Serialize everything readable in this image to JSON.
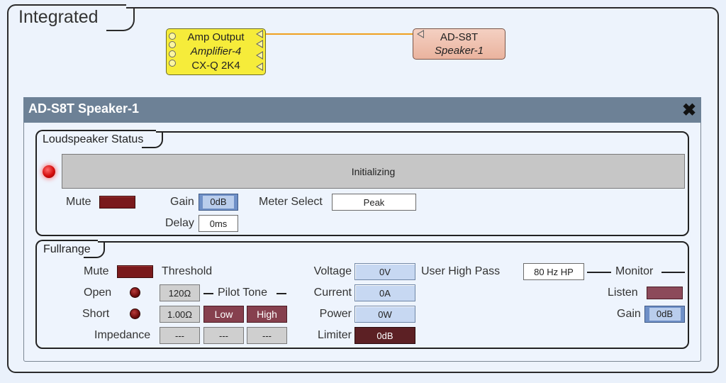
{
  "design": {
    "title": "Integrated"
  },
  "amp_node": {
    "line1": "Amp Output",
    "line2": "Amplifier-4",
    "line3": "CX-Q 2K4",
    "color": "#f6ec3a"
  },
  "speaker_node": {
    "line1": "AD-S8T",
    "line2": "Speaker-1",
    "color": "#eab39e"
  },
  "wire": {
    "color": "#f0a020"
  },
  "dialog": {
    "title": "AD-S8T Speaker-1",
    "close_icon": "close-icon",
    "header_color": "#6d8196"
  },
  "loudspeaker_status": {
    "title": "Loudspeaker Status",
    "status_text": "Initializing",
    "mute_label": "Mute",
    "gain_label": "Gain",
    "gain_value": "0dB",
    "meter_select_label": "Meter Select",
    "meter_select_value": "Peak",
    "delay_label": "Delay",
    "delay_value": "0ms"
  },
  "fullrange": {
    "title": "Fullrange",
    "mute_label": "Mute",
    "threshold_label": "Threshold",
    "open_label": "Open",
    "open_value": "120Ω",
    "pilot_tone_label": "Pilot Tone",
    "short_label": "Short",
    "short_value": "1.00Ω",
    "low_label": "Low",
    "high_label": "High",
    "impedance_label": "Impedance",
    "impedance_values": [
      "---",
      "---",
      "---"
    ],
    "voltage_label": "Voltage",
    "voltage_value": "0V",
    "current_label": "Current",
    "current_value": "0A",
    "power_label": "Power",
    "power_value": "0W",
    "limiter_label": "Limiter",
    "limiter_value": "0dB",
    "user_high_pass_label": "User High Pass",
    "user_high_pass_value": "80 Hz HP",
    "monitor_label": "Monitor",
    "listen_label": "Listen",
    "gain_label": "Gain",
    "gain_value": "0dB"
  }
}
